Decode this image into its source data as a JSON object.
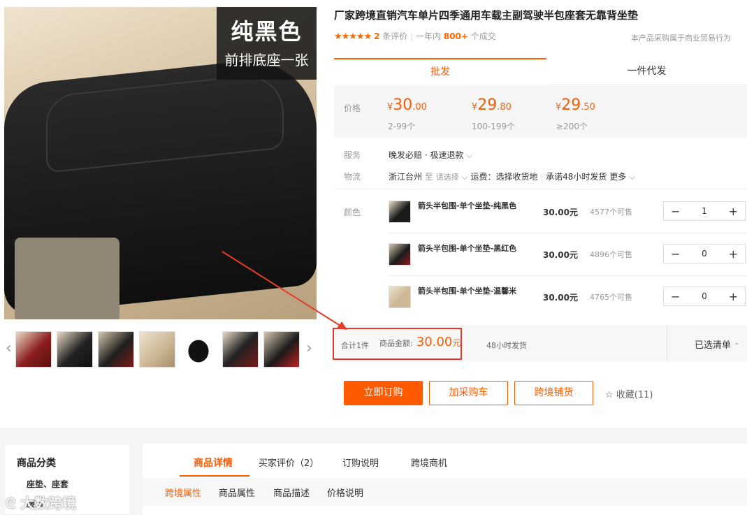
{
  "main_image": {
    "tag_line1": "纯黑色",
    "tag_line2": "前排底座一张"
  },
  "product": {
    "title": "厂家跨境直销汽车单片四季通用车载主副驾驶半包座套无靠背坐垫",
    "stars": "★★★★★",
    "review_count": "2",
    "review_suffix": "条评价",
    "year_prefix": "一年内",
    "year_count": "800+",
    "year_suffix": "个成交",
    "behavior_note": "本产品采购属于商业贸易行为"
  },
  "tabs": {
    "wholesale": "批发",
    "dropship": "一件代发"
  },
  "pricing": {
    "label": "价格",
    "tiers": [
      {
        "symbol": "¥",
        "int": "30",
        "dec": ".00",
        "qty": "2-99个"
      },
      {
        "symbol": "¥",
        "int": "29",
        "dec": ".80",
        "qty": "100-199个"
      },
      {
        "symbol": "¥",
        "int": "29",
        "dec": ".50",
        "qty": "≥200个"
      }
    ]
  },
  "service": {
    "label": "服务",
    "value": "晚发必赔 · 极速退款"
  },
  "logistics": {
    "label": "物流",
    "origin": "浙江台州",
    "to": "至",
    "select": "请选择",
    "fee": "运费：选择收货地",
    "promise": "承诺48小时发货",
    "more": "更多"
  },
  "color": {
    "label": "颜色"
  },
  "variants": [
    {
      "name": "箭头半包围-单个坐垫-纯黑色",
      "price": "30.00元",
      "stock": "4577个可售",
      "qty": "1"
    },
    {
      "name": "箭头半包围-单个坐垫-黑红色",
      "price": "30.00元",
      "stock": "4896个可售",
      "qty": "0"
    },
    {
      "name": "箭头半包围-单个坐垫-温馨米",
      "price": "30.00元",
      "stock": "4765个可售",
      "qty": "0"
    }
  ],
  "stepper": {
    "minus": "−",
    "plus": "+"
  },
  "summary": {
    "count": "合计1件",
    "amount_label": "商品金额:",
    "amount": "30.00",
    "unit": "元",
    "ship": "48小时发货",
    "cart_list": "已选清单"
  },
  "actions": {
    "order": "立即订购",
    "add_cart": "加采购车",
    "crossborder": "跨境铺货",
    "favorite": "收藏(11)"
  },
  "category": {
    "title": "商品分类",
    "item1": "座垫、座套",
    "item2": "腰靠"
  },
  "detail_tabs": [
    "商品详情",
    "买家评价（2）",
    "订购说明",
    "跨境商机"
  ],
  "sub_tabs": [
    "跨境属性",
    "商品属性",
    "商品描述",
    "价格说明"
  ],
  "watermark": "大数跨境",
  "colors": {
    "accent": "#ff5a00",
    "highlight": "#e53c2b"
  }
}
